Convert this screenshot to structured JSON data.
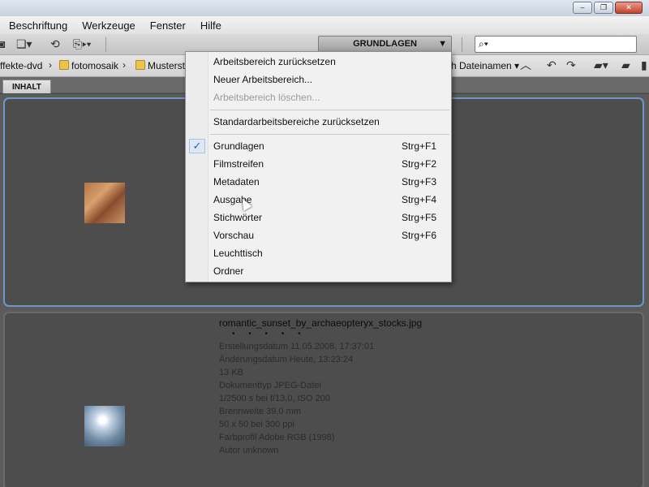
{
  "window": {
    "controls": {
      "minimize": "–",
      "restore": "❐",
      "close": "✕"
    }
  },
  "menubar": {
    "items": [
      "Beschriftung",
      "Werkzeuge",
      "Fenster",
      "Hilfe"
    ]
  },
  "toolbar": {
    "workspace_label": "GRUNDLAGEN",
    "workspace_arrow": "▼",
    "search_placeholder": "⌕▾"
  },
  "pathbar": {
    "items": [
      "ffekte-dvd",
      "fotomosaik",
      "Musterst"
    ],
    "sort_label": "h Dateinamen ▾"
  },
  "tabs": {
    "content_tab": "INHALT"
  },
  "files": [
    {
      "name": "romantic_sunset_by_archaeopteryx_stocks.jpg",
      "stars": "• • • • •",
      "meta": [
        "Erstellungsdatum 11.05.2008, 17:37:01",
        "Änderungsdatum Heute, 13:23:24",
        "13 KB",
        "Dokumenttyp JPEG-Datei",
        "1/2500 s bei f/13,0, ISO 200",
        "Brennweite 39,0 mm",
        "50 x 50 bei 300 ppi",
        "Farbprofil Adobe RGB (1998)",
        "Autor unknown"
      ]
    }
  ],
  "dropdown": {
    "group1": [
      "Arbeitsbereich zurücksetzen",
      "Neuer Arbeitsbereich...",
      "Arbeitsbereich löschen..."
    ],
    "group2": [
      "Standardarbeitsbereiche zurücksetzen"
    ],
    "workspaces": [
      {
        "label": "Grundlagen",
        "shortcut": "Strg+F1",
        "checked": true
      },
      {
        "label": "Filmstreifen",
        "shortcut": "Strg+F2"
      },
      {
        "label": "Metadaten",
        "shortcut": "Strg+F3"
      },
      {
        "label": "Ausgabe",
        "shortcut": "Strg+F4"
      },
      {
        "label": "Stichwörter",
        "shortcut": "Strg+F5"
      },
      {
        "label": "Vorschau",
        "shortcut": "Strg+F6"
      },
      {
        "label": "Leuchttisch",
        "shortcut": ""
      },
      {
        "label": "Ordner",
        "shortcut": ""
      }
    ],
    "check_mark": "✓"
  }
}
